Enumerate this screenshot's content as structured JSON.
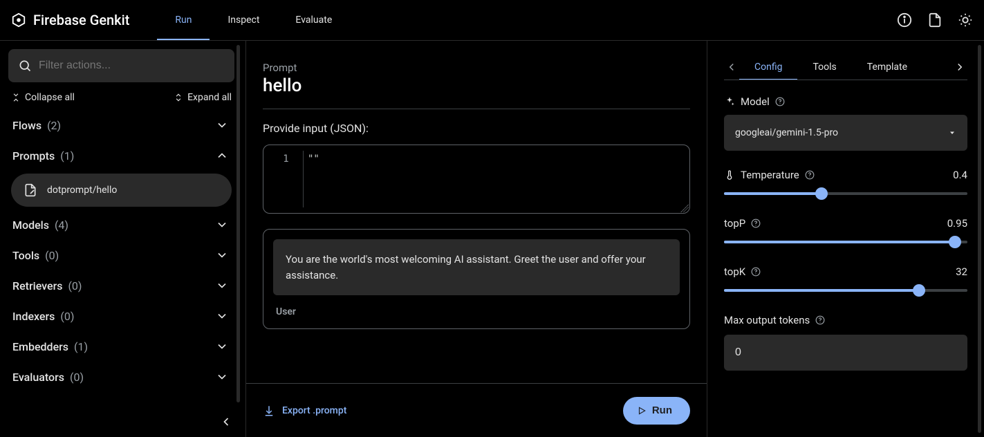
{
  "brand": {
    "name": "Firebase Genkit"
  },
  "topTabs": {
    "run": "Run",
    "inspect": "Inspect",
    "evaluate": "Evaluate"
  },
  "sidebar": {
    "searchPlaceholder": "Filter actions...",
    "collapseAll": "Collapse all",
    "expandAll": "Expand all",
    "groups": {
      "flows": {
        "label": "Flows",
        "count": "(2)"
      },
      "prompts": {
        "label": "Prompts",
        "count": "(1)"
      },
      "models": {
        "label": "Models",
        "count": "(4)"
      },
      "tools": {
        "label": "Tools",
        "count": "(0)"
      },
      "retrievers": {
        "label": "Retrievers",
        "count": "(0)"
      },
      "indexers": {
        "label": "Indexers",
        "count": "(0)"
      },
      "embedders": {
        "label": "Embedders",
        "count": "(1)"
      },
      "evaluators": {
        "label": "Evaluators",
        "count": "(0)"
      }
    },
    "promptItem": "dotprompt/hello"
  },
  "center": {
    "crumb": "Prompt",
    "title": "hello",
    "inputLabel": "Provide input (JSON):",
    "lineNum": "1",
    "codeValue": "\"\"",
    "systemMsg": "You are the world's most welcoming AI assistant. Greet the user and offer your assistance.",
    "userLbl": "User",
    "export": "Export .prompt",
    "run": "Run"
  },
  "rpanel": {
    "tabs": {
      "config": "Config",
      "tools": "Tools",
      "template": "Template"
    },
    "modelLabel": "Model",
    "modelValue": "googleai/gemini-1.5-pro",
    "params": {
      "temperature": {
        "label": "Temperature",
        "value": "0.4",
        "pct": 40
      },
      "topP": {
        "label": "topP",
        "value": "0.95",
        "pct": 95
      },
      "topK": {
        "label": "topK",
        "value": "32",
        "pct": 80
      },
      "maxTokens": {
        "label": "Max output tokens",
        "value": "0"
      }
    }
  }
}
